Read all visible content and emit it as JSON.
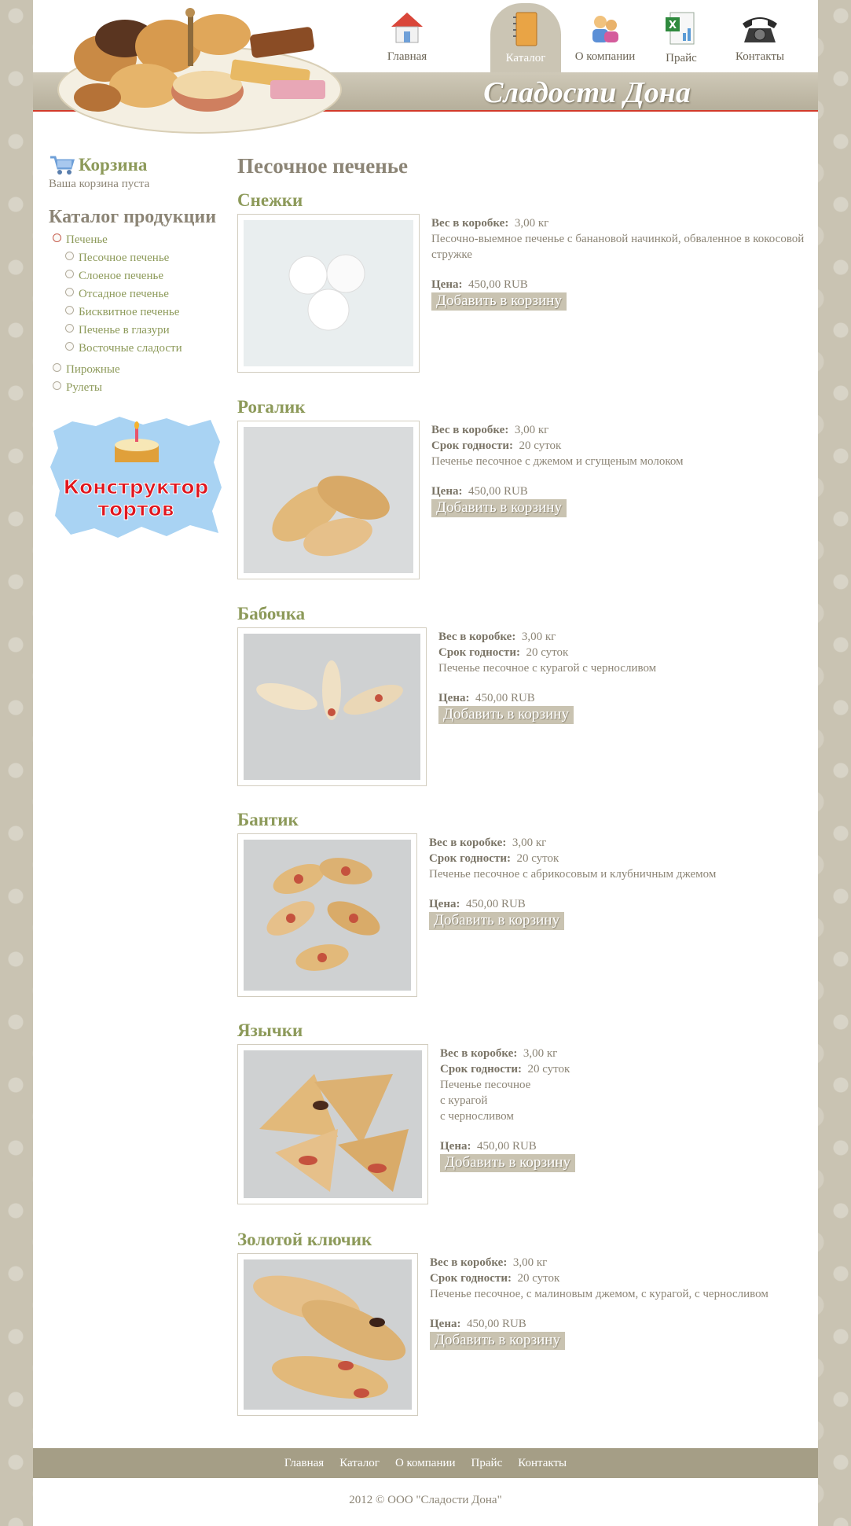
{
  "site": {
    "title": "Сладости Дона"
  },
  "nav": [
    {
      "label": "Главная",
      "icon": "home-icon"
    },
    {
      "label": "Каталог",
      "icon": "notebook-icon",
      "active": true
    },
    {
      "label": "О компании",
      "icon": "people-icon"
    },
    {
      "label": "Прайс",
      "icon": "excel-icon"
    },
    {
      "label": "Контакты",
      "icon": "telephone-icon"
    }
  ],
  "sidebar": {
    "cart_title": "Корзина",
    "cart_status": "Ваша корзина пуста",
    "catalog_title": "Каталог продукции",
    "catalog": [
      {
        "label": "Печенье",
        "children": [
          "Песочное печенье",
          "Слоеное печенье",
          "Отсадное печенье",
          "Бисквитное печенье",
          "Печенье в глазури",
          "Восточные сладости"
        ]
      },
      {
        "label": "Пирожные"
      },
      {
        "label": "Рулеты"
      }
    ],
    "banner": {
      "line1": "Конструктор",
      "line2": "тортов"
    }
  },
  "main": {
    "heading": "Песочное печенье",
    "labels": {
      "weight": "Вес в коробке:",
      "shelf": "Срок годности:",
      "price": "Цена:"
    },
    "add_label": "Добавить в корзину",
    "products": [
      {
        "name": "Снежки",
        "weight": "3,00 кг",
        "desc": "Песочно-выемное печенье с банановой начинкой, обваленное в кокосовой стружке",
        "price": "450,00 RUB"
      },
      {
        "name": "Рогалик",
        "weight": "3,00 кг",
        "shelf": "20 суток",
        "desc": "Печенье песочное с джемом и сгущеным молоком",
        "price": "450,00 RUB"
      },
      {
        "name": "Бабочка",
        "weight": "3,00 кг",
        "shelf": "20 суток",
        "desc": "Печенье песочное с курагой с черносливом",
        "price": "450,00 RUB"
      },
      {
        "name": "Бантик",
        "weight": "3,00 кг",
        "shelf": "20 суток",
        "desc": "Печенье песочное с абрикосовым и клубничным джемом",
        "price": "450,00 RUB"
      },
      {
        "name": "Язычки",
        "weight": "3,00 кг",
        "shelf": "20 суток",
        "desc": "Печенье песочное\nс курагой\nс черносливом",
        "price": "450,00 RUB"
      },
      {
        "name": "Золотой ключик",
        "weight": "3,00 кг",
        "shelf": "20 суток",
        "desc": "Печенье песочное, с малиновым джемом, с курагой, с черносливом",
        "price": "450,00 RUB"
      }
    ]
  },
  "footer": {
    "links": [
      "Главная",
      "Каталог",
      "О компании",
      "Прайс",
      "Контакты"
    ],
    "copyright": "2012 © ООО \"Сладости Дона\""
  }
}
